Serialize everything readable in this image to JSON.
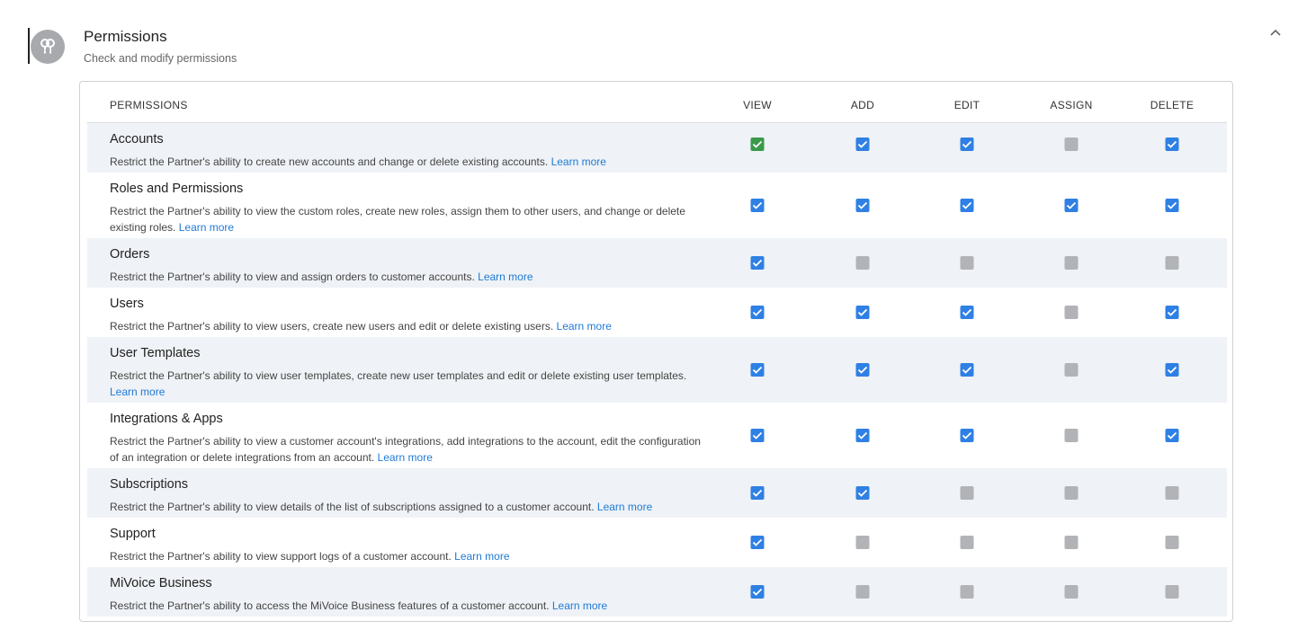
{
  "header": {
    "title": "Permissions",
    "subtitle": "Check and modify permissions",
    "icon": "keys-icon",
    "collapse_icon": "chevron-up-icon"
  },
  "table": {
    "columns": [
      "PERMISSIONS",
      "VIEW",
      "ADD",
      "EDIT",
      "ASSIGN",
      "DELETE"
    ],
    "learn_more_label": "Learn more",
    "colors": {
      "checked": "#2f80e4",
      "checked_focus": "#3a9a49",
      "disabled": "#b1b3b6",
      "link": "#1f7ad6",
      "row_shade": "#eff2f6"
    },
    "rows": [
      {
        "title": "Accounts",
        "description": "Restrict the Partner's ability to create new accounts and change or delete existing accounts.",
        "view": "checked-focus",
        "add": "checked",
        "edit": "checked",
        "assign": "disabled",
        "delete": "checked"
      },
      {
        "title": "Roles and Permissions",
        "description": "Restrict the Partner's ability to view the custom roles, create new roles, assign them to other users, and change or delete existing roles.",
        "view": "checked",
        "add": "checked",
        "edit": "checked",
        "assign": "checked",
        "delete": "checked"
      },
      {
        "title": "Orders",
        "description": "Restrict the Partner's ability to view and assign orders to customer accounts.",
        "view": "checked",
        "add": "disabled",
        "edit": "disabled",
        "assign": "disabled",
        "delete": "disabled"
      },
      {
        "title": "Users",
        "description": "Restrict the Partner's ability to view users, create new users and edit or delete existing users.",
        "view": "checked",
        "add": "checked",
        "edit": "checked",
        "assign": "disabled",
        "delete": "checked"
      },
      {
        "title": "User Templates",
        "description": "Restrict the Partner's ability to view user templates, create new user templates and edit or delete existing user templates.",
        "view": "checked",
        "add": "checked",
        "edit": "checked",
        "assign": "disabled",
        "delete": "checked"
      },
      {
        "title": "Integrations & Apps",
        "description": "Restrict the Partner's ability to view a customer account's integrations, add integrations to the account, edit the configuration of an integration or delete integrations from an account.",
        "view": "checked",
        "add": "checked",
        "edit": "checked",
        "assign": "disabled",
        "delete": "checked"
      },
      {
        "title": "Subscriptions",
        "description": "Restrict the Partner's ability to view details of the list of subscriptions assigned to a customer account.",
        "view": "checked",
        "add": "checked",
        "edit": "disabled",
        "assign": "disabled",
        "delete": "disabled"
      },
      {
        "title": "Support",
        "description": "Restrict the Partner's ability to view support logs of a customer account.",
        "view": "checked",
        "add": "disabled",
        "edit": "disabled",
        "assign": "disabled",
        "delete": "disabled"
      },
      {
        "title": "MiVoice Business",
        "description": "Restrict the Partner's ability to access the MiVoice Business features of a customer account.",
        "view": "checked",
        "add": "disabled",
        "edit": "disabled",
        "assign": "disabled",
        "delete": "disabled"
      }
    ]
  }
}
